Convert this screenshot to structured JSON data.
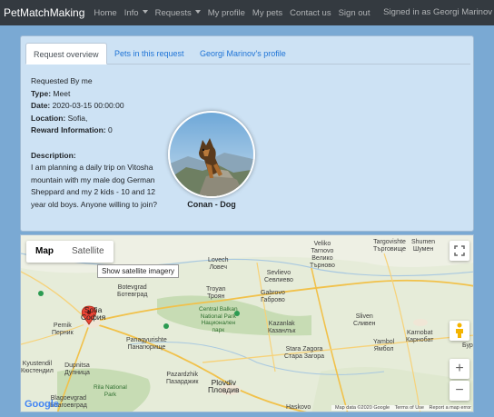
{
  "navbar": {
    "brand": "PetMatchMaking",
    "links": [
      "Home",
      "Info",
      "Requests",
      "My profile",
      "My pets",
      "Contact us",
      "Sign out"
    ],
    "signed_in": "Signed in as Georgi Marinov"
  },
  "tabs": [
    "Request overview",
    "Pets in this request",
    "Georgi Marinov's profile"
  ],
  "request": {
    "requested_by": "Requested By me",
    "type_label": "Type:",
    "type_value": "Meet",
    "date_label": "Date:",
    "date_value": "2020-03-15 00:00:00",
    "location_label": "Location:",
    "location_value": "Sofia,",
    "reward_label": "Reward Information:",
    "reward_value": "0",
    "description_label": "Description:",
    "description_text": "I am planning a daily trip on Vitosha mountain with my male dog German Sheppard and my 2 kids - 10 and 12 year old boys. Anyone willing to join?"
  },
  "pet": {
    "name": "Conan - Dog"
  },
  "map": {
    "map_label": "Map",
    "satellite_label": "Satellite",
    "tooltip": "Show satellite imagery",
    "zoom_in": "+",
    "zoom_out": "−",
    "google": "Google",
    "map_data": "Map data ©2020 Google",
    "terms": "Terms of Use",
    "report": "Report a map error",
    "places": {
      "lovech": "Lovech\nЛовеч",
      "veliko": "Veliko\nTarnovo\nВелико\nТърново",
      "targovishte": "Targovishte\nТърговище",
      "shumen": "Shumen\nШумен",
      "sevlievo": "Sevlievo\nСевлиево",
      "gabrovo": "Gabrovo\nГаброво",
      "troyan": "Troyan\nТроян",
      "botevgrad": "Botevgrad\nБотевград",
      "sofia": "Sofia\nСофия",
      "pernik": "Pernik\nПерник",
      "central_balkan": "Central Balkan\nNational Park\nНационален\nпарк",
      "sliven": "Sliven\nСливен",
      "kazanlak": "Kazanlak\nКазанлък",
      "panagyurishte": "Panagyurishte\nПанагюрище",
      "stara_zagora": "Stara Zagora\nСтара Загора",
      "yambol": "Yambol\nЯмбол",
      "karnobat": "Karnobat\nКарнобат",
      "pazardzhik": "Pazardzhik\nПазарджик",
      "plovdiv": "Plovdiv\nПловдив",
      "rila": "Rila National\nPark",
      "blagoevgrad": "Blagoevgrad\nБлагоевград",
      "dupnitsa": "Dupnitsa\nДупница",
      "haskovo": "Haskovo",
      "kyustendil": "Kyustendil\nКюстендил",
      "burgas": "Бург"
    }
  }
}
